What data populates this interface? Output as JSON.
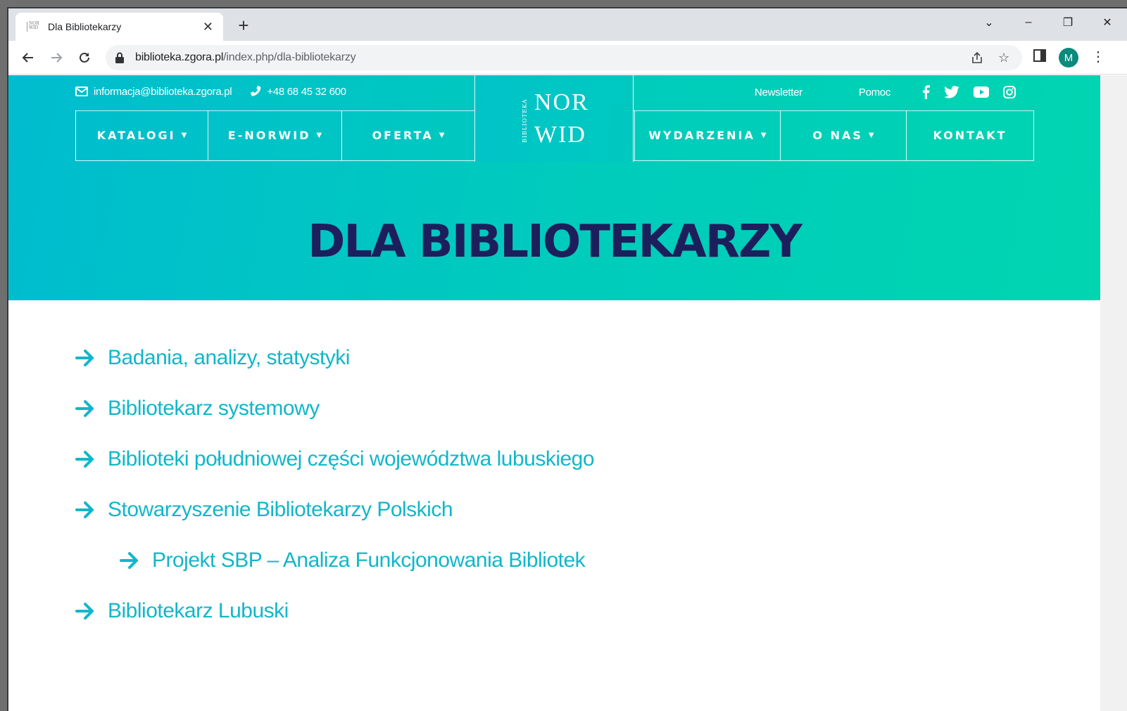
{
  "browser": {
    "tab": {
      "title": "Dla Bibliotekarzy",
      "favicon_text": "NOR WID"
    },
    "url": {
      "host": "biblioteka.zgora.pl",
      "path": "/index.php/dla-bibliotekarzy"
    },
    "profile_initial": "M",
    "icons": [
      "back-icon",
      "forward-icon",
      "reload-icon",
      "lock-icon",
      "share-icon",
      "star-icon",
      "sidepanel-icon",
      "menu-icon"
    ]
  },
  "header": {
    "email": "informacja@biblioteka.zgora.pl",
    "phone": "+48 68 45 32 600",
    "newsletter": "Newsletter",
    "help": "Pomoc",
    "social_icons": [
      "facebook-icon",
      "twitter-icon",
      "youtube-icon",
      "instagram-icon"
    ],
    "logo": {
      "vertical": "BIBLIOTEKA",
      "line1": "NOR",
      "line2": "WID"
    }
  },
  "nav": {
    "items": [
      {
        "label": "KATALOGI",
        "has_dropdown": true
      },
      {
        "label": "E-NORWID",
        "has_dropdown": true
      },
      {
        "label": "OFERTA",
        "has_dropdown": true
      },
      {
        "label": "WYDARZENIA",
        "has_dropdown": true
      },
      {
        "label": "O NAS",
        "has_dropdown": true
      },
      {
        "label": "KONTAKT",
        "has_dropdown": false
      }
    ]
  },
  "page": {
    "title": "DLA BIBLIOTEKARZY",
    "links": [
      {
        "label": "Badania, analizy, statystyki",
        "level": 0
      },
      {
        "label": "Bibliotekarz systemowy",
        "level": 0
      },
      {
        "label": "Biblioteki południowej części województwa lubuskiego",
        "level": 0
      },
      {
        "label": "Stowarzyszenie Bibliotekarzy Polskich",
        "level": 0
      },
      {
        "label": "Projekt SBP – Analiza Funkcjonowania Bibliotek",
        "level": 1
      },
      {
        "label": "Bibliotekarz Lubuski",
        "level": 0
      }
    ]
  },
  "colors": {
    "accent": "#10b7c9",
    "title": "#1c1f5c",
    "hero_start": "#00bccf",
    "hero_end": "#00d5b0"
  }
}
